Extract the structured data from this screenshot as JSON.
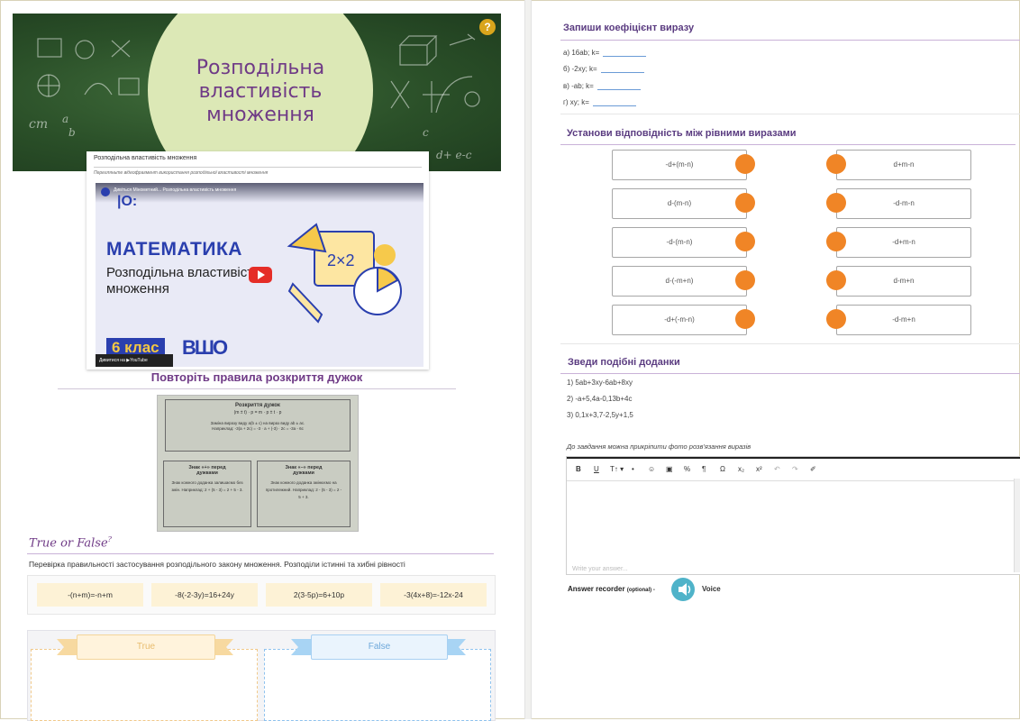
{
  "left": {
    "banner": {
      "title": "Розподільна властивість множення",
      "help": "?",
      "chalk": [
        "cm",
        "a",
        "b",
        "c",
        "d+ e-c"
      ]
    },
    "video_card": {
      "title": "Розподільна властивість множення",
      "description": "Перегляньте відеофрагмент використання розподільної властивості множення",
      "video_top": "Дивіться Мінометний... Розподільна властивість множення",
      "subject": "МАТЕМАТИКА",
      "topic": "Розподільна властивість множення",
      "grade": "6 клас",
      "brand": "ВШО",
      "card_label": "2×2",
      "watch_on": "Дивитися на ▶YouTube"
    },
    "rules": {
      "heading": "Повторіть правила розкриття дужок",
      "photo": {
        "title": "Розкриття дужок",
        "formula": "(m ± t) · p = m · p ± t · p",
        "text1": "Заміна виразу виду a(b ± c) на вираз виду ab ± ac.",
        "text2": "Наприклад: -3(a + 2c) = -3 · a + (-3) · 2c = -3a - 6c",
        "plus_title": "Знак «+» перед дужками",
        "plus_text": "Знак кожного доданка залишаємо без змін. Наприклад: 2 + (5 - 3) = 2 + 5 - 3.",
        "minus_title": "Знак «–» перед дужками",
        "minus_text": "Знак кожного доданка змінюємо на протилежний. Наприклад: 2 - (5 - 3) = 2 - 5 + 3."
      }
    },
    "true_false": {
      "heading": "True or False",
      "description": "Перевірка правильності застосування розподільного закону множення. Розподіли істинні та хибні рівності",
      "cards": [
        "-(n+m)=-n+m",
        "-8(-2-3y)=16+24y",
        "2(3-5p)=6+10p",
        "-3(4x+8)=-12x-24"
      ],
      "true_label": "True",
      "false_label": "False"
    }
  },
  "right": {
    "coef": {
      "heading": "Запиши коефіцієнт виразу",
      "items": [
        "а) 16ab; k=",
        "б) -2xy; k=",
        "в) -ab; k=",
        "г) xy; k="
      ]
    },
    "matching": {
      "heading": "Установи відповідність між рівними виразами",
      "left": [
        "-d+(m-n)",
        "d-(m-n)",
        "-d-(m-n)",
        "d-(-m+n)",
        "-d+(-m-n)"
      ],
      "right": [
        "d+m-n",
        "-d-m-n",
        "-d+m-n",
        "d-m+n",
        "-d-m+n"
      ],
      "dot_color": "#f08526"
    },
    "similar": {
      "heading": "Зведи подібні доданки",
      "items": [
        "1) 5ab+3xy-6ab+8xy",
        "2) -a+5,4a-0,13b+4c",
        "3) 0,1x+3,7-2,5y+1,5"
      ],
      "attach_note": "До завдання можна прикріпити фото розв'язання виразів"
    },
    "editor": {
      "toolbar": [
        "B",
        "U",
        "T↑ ▾",
        "•",
        "☺",
        "▣",
        "%",
        "¶",
        "Ω",
        "x₂",
        "x²",
        "↶",
        "↷",
        "✐"
      ],
      "placeholder": "Write your answer..."
    },
    "recorder": {
      "label": "Answer recorder",
      "optional": "(optional) -",
      "voice": "Voice"
    }
  }
}
